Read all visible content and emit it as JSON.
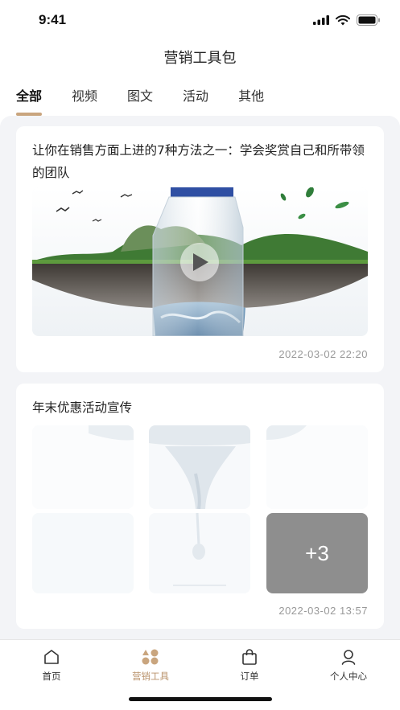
{
  "status_bar": {
    "time": "9:41"
  },
  "header": {
    "title": "营销工具包"
  },
  "tabs": [
    {
      "label": "全部",
      "active": true
    },
    {
      "label": "视频",
      "active": false
    },
    {
      "label": "图文",
      "active": false
    },
    {
      "label": "活动",
      "active": false
    },
    {
      "label": "其他",
      "active": false
    }
  ],
  "posts": [
    {
      "title": "让你在销售方面上进的7种方法之一：学会奖赏自己和所带领的团队",
      "media": "video",
      "timestamp": "2022-03-02   22:20"
    },
    {
      "title": "年末优惠活动宣传",
      "media": "image-grid",
      "more_count": "+3",
      "timestamp": "2022-03-02   13:57"
    }
  ],
  "tab_bar": [
    {
      "label": "首页",
      "icon": "home-icon",
      "active": false
    },
    {
      "label": "营销工具",
      "icon": "marketing-tools-icon",
      "active": true
    },
    {
      "label": "订单",
      "icon": "order-bag-icon",
      "active": false
    },
    {
      "label": "个人中心",
      "icon": "profile-icon",
      "active": false
    }
  ],
  "colors": {
    "accent": "#c9a57e",
    "accent_text": "#b8916a",
    "background": "#f3f4f7"
  }
}
